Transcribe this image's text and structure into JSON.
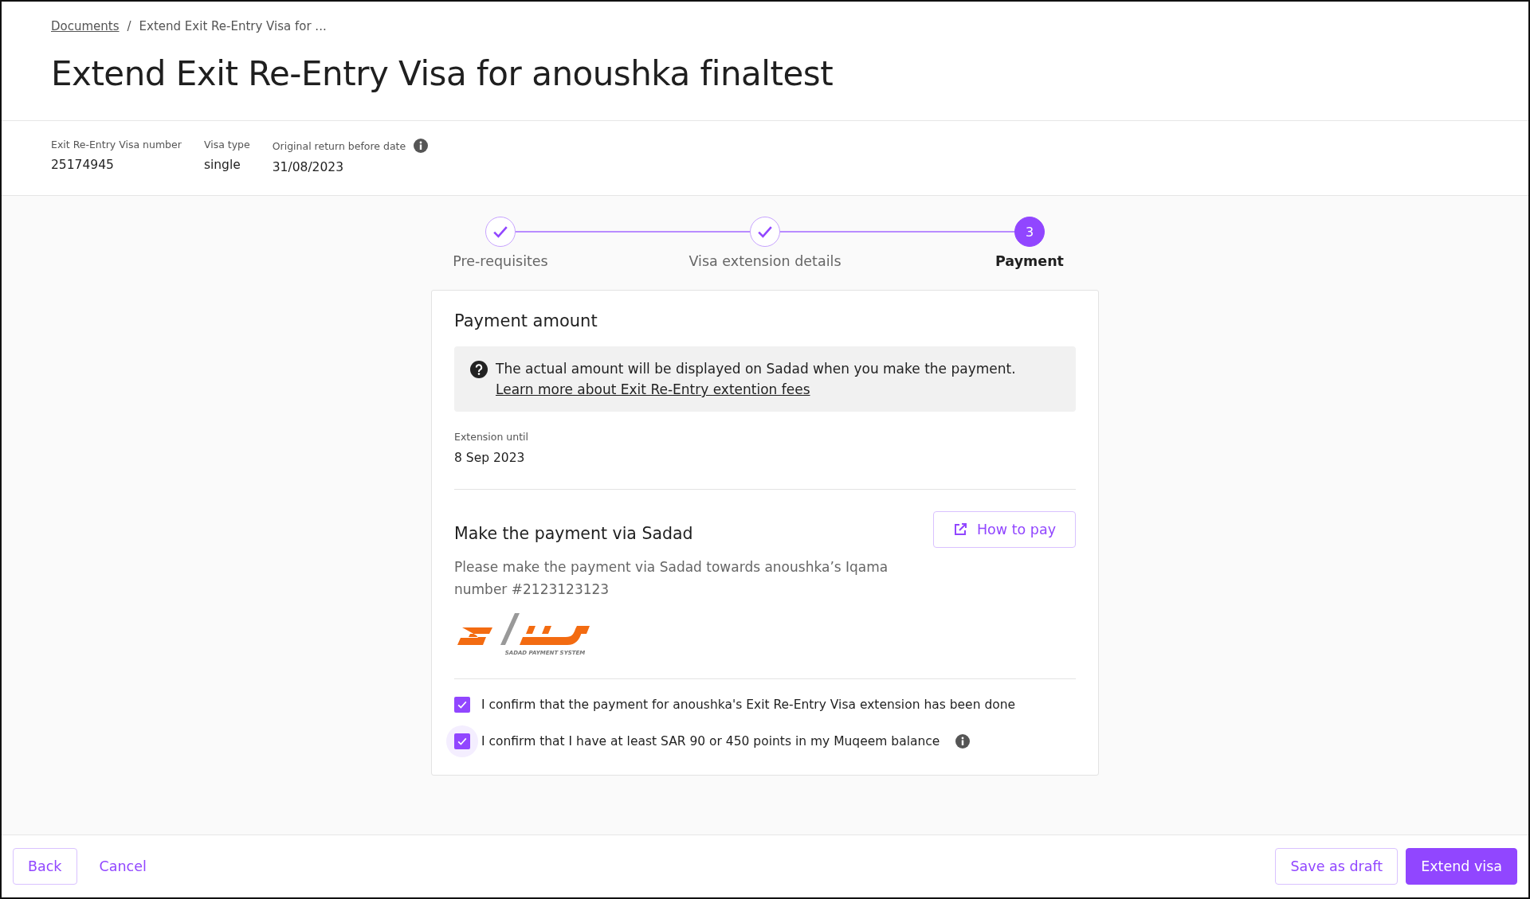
{
  "breadcrumb": {
    "link": "Documents",
    "separator": "/",
    "current": "Extend Exit Re-Entry Visa for ..."
  },
  "title": "Extend Exit Re-Entry Visa for anoushka finaltest",
  "meta": [
    {
      "label": "Exit Re-Entry Visa number",
      "value": "25174945",
      "info": false
    },
    {
      "label": "Visa type",
      "value": "single",
      "info": false
    },
    {
      "label": "Original return before date",
      "value": "31/08/2023",
      "info": true
    }
  ],
  "steps": [
    {
      "label": "Pre-requisites",
      "kind": "done"
    },
    {
      "label": "Visa extension details",
      "kind": "done"
    },
    {
      "label": "Payment",
      "kind": "current",
      "number": "3"
    }
  ],
  "card": {
    "heading": "Payment amount",
    "notice": {
      "text": "The actual amount will be displayed on Sadad when you make the payment.",
      "link": "Learn more about Exit Re-Entry extention fees"
    },
    "extension": {
      "label": "Extension until",
      "value": "8 Sep 2023"
    },
    "sadad": {
      "heading": "Make the payment via Sadad",
      "button": "How to pay",
      "text": "Please make the payment via Sadad towards anoushka’s Iqama number #2123123123",
      "logo_caption": "SADAD PAYMENT SYSTEM"
    },
    "confirmations": [
      {
        "label": "I confirm that the payment for anoushka's Exit Re-Entry Visa extension has been done",
        "checked": true,
        "focused": false,
        "info": false
      },
      {
        "label": "I confirm that I have at least SAR 90 or 450 points in my Muqeem balance",
        "checked": true,
        "focused": true,
        "info": true
      }
    ]
  },
  "footer": {
    "left": [
      {
        "label": "Back",
        "kind": "outline"
      },
      {
        "label": "Cancel",
        "kind": "text"
      }
    ],
    "right": [
      {
        "label": "Save as draft",
        "kind": "outline"
      },
      {
        "label": "Extend visa",
        "kind": "primary"
      }
    ]
  }
}
